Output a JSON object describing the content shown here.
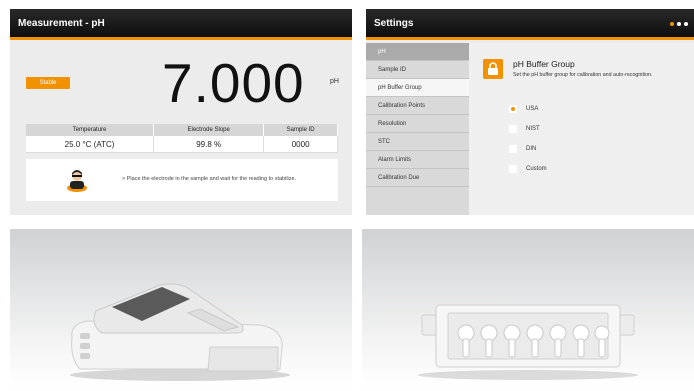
{
  "measurement": {
    "title": "Measurement - pH",
    "status_badge": "Stable",
    "reading": "7.000",
    "unit": "pH",
    "table": {
      "headers": [
        "Temperature",
        "Electrode Slope",
        "Sample ID"
      ],
      "values": [
        "25.0 °C (ATC)",
        "99.8 %",
        "0000"
      ]
    },
    "hint": "> Place the electrode in the sample and wait for the reading to stabilize."
  },
  "settings": {
    "title": "Settings",
    "menu": [
      {
        "label": "pH"
      },
      {
        "label": "Sample ID"
      },
      {
        "label": "pH Buffer Group"
      },
      {
        "label": "Calibration Points"
      },
      {
        "label": "Resolution"
      },
      {
        "label": "STC"
      },
      {
        "label": "Alarm Limits"
      },
      {
        "label": "Calibration Due"
      }
    ],
    "group_title": "pH Buffer Group",
    "group_desc": "Set the pH buffer group for calibration and auto-recognition.",
    "options": [
      {
        "label": "USA",
        "selected": true
      },
      {
        "label": "NIST",
        "selected": false
      },
      {
        "label": "DIN",
        "selected": false
      },
      {
        "label": "Custom",
        "selected": false
      }
    ]
  },
  "colors": {
    "accent": "#f39200",
    "titlebar": "#111111"
  },
  "icons": {
    "operator": "operator-icon",
    "lock": "lock-icon"
  }
}
